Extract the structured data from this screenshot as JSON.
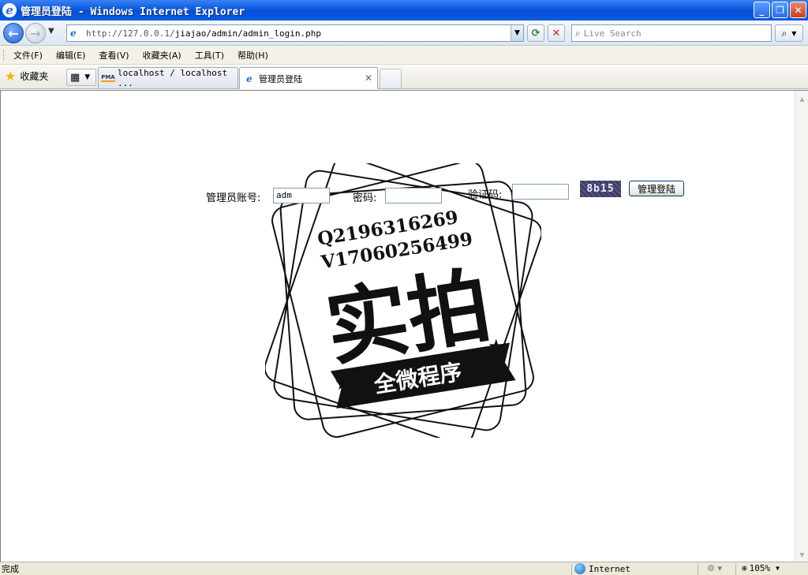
{
  "window": {
    "title": "管理员登陆 - Windows Internet Explorer",
    "minimize": "_",
    "restore": "❐",
    "close": "✕"
  },
  "address": {
    "url_host": "http://127.0.0.1/",
    "url_path": "jiajao/admin/admin_login.php",
    "search_placeholder": "Live Search"
  },
  "menu": [
    "文件(F)",
    "编辑(E)",
    "查看(V)",
    "收藏夹(A)",
    "工具(T)",
    "帮助(H)"
  ],
  "favorites": {
    "label": "收藏夹"
  },
  "tabs": [
    {
      "label": "localhost / localhost ...",
      "icon": "phpmyadmin-icon",
      "icon_text": "PMA"
    },
    {
      "label": "管理员登陆",
      "icon": "ie-page-icon",
      "active": true
    }
  ],
  "form": {
    "account_label": "管理员账号:",
    "account_value": "adm",
    "password_label": "密码:",
    "password_value": "",
    "captcha_label": "验证码:",
    "captcha_value": "",
    "captcha_image_text": "8b15",
    "login_button": "管理登陆"
  },
  "watermark": {
    "line1": "Q2196316269",
    "line2": "V17060256499",
    "big_text": "实拍",
    "ribbon_text": "全微程序"
  },
  "status": {
    "text": "完成",
    "zone": "Internet",
    "zoom": "105%"
  },
  "colors": {
    "titlebar": "#0a5ae0",
    "status_bg": "#ece9d8",
    "captcha_bg": "#3b3b66"
  }
}
